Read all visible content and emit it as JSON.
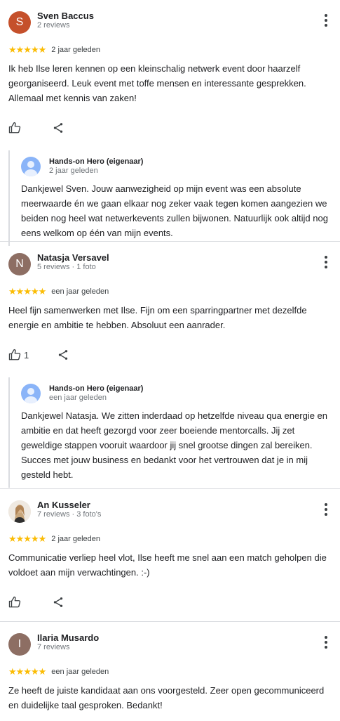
{
  "reviews": [
    {
      "initial": "S",
      "avatar_color": "#c5502b",
      "name": "Sven Baccus",
      "meta": "2 reviews",
      "stars": "★★★★★",
      "when": "2 jaar geleden",
      "text": "Ik heb Ilse leren kennen op een kleinschalig netwerk event door haarzelf georganiseerd. Leuk event met toffe mensen en interessante gesprekken. Allemaal met kennis van zaken!",
      "likes": "",
      "reply": {
        "name": "Hands-on Hero (eigenaar)",
        "when": "2 jaar geleden",
        "text": "Dankjewel Sven. Jouw aanwezigheid op mijn event was een absolute meerwaarde én we gaan elkaar nog zeker vaak tegen komen aangezien we beiden nog heel wat netwerkevents zullen bijwonen. Natuurlijk ook altijd nog eens welkom op één van mijn events."
      }
    },
    {
      "initial": "N",
      "avatar_color": "#8d6e63",
      "name": "Natasja Versavel",
      "meta": "5 reviews · 1 foto",
      "stars": "★★★★★",
      "when": "een jaar geleden",
      "text": "Heel fijn samenwerken met Ilse. Fijn om een sparringpartner met dezelfde energie en ambitie te hebben. Absoluut een aanrader.",
      "likes": "1",
      "reply": {
        "name": "Hands-on Hero (eigenaar)",
        "when": "een jaar geleden",
        "text": "Dankjewel Natasja. We zitten inderdaad op hetzelfde niveau qua energie en ambitie en dat heeft gezorgd voor zeer boeiende mentorcalls. Jij zet geweldige stappen vooruit waardoor jij snel grootse dingen zal bereiken. Succes met jouw business en bedankt voor het vertrouwen dat je in mij gesteld hebt."
      }
    },
    {
      "initial": "",
      "avatar_color": "#e8e1d8",
      "name": "An Kusseler",
      "meta": "7 reviews · 3 foto's",
      "stars": "★★★★★",
      "when": "2 jaar geleden",
      "text": "Communicatie verliep heel vlot, Ilse heeft me snel aan een match geholpen die voldoet aan mijn verwachtingen. :-)",
      "likes": ""
    },
    {
      "initial": "I",
      "avatar_color": "#8d6e63",
      "name": "Ilaria Musardo",
      "meta": "7 reviews",
      "stars": "★★★★★",
      "when": "een jaar geleden",
      "text": "Ze heeft de juiste kandidaat aan ons voorgesteld. Zeer open gecommuniceerd en duidelijke taal gesproken. Bedankt!",
      "likes": ""
    }
  ]
}
